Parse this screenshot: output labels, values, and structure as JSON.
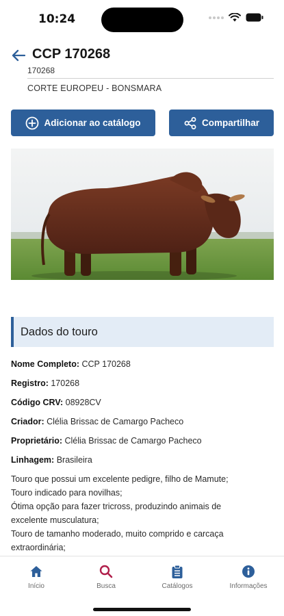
{
  "status": {
    "time": "10:24"
  },
  "header": {
    "title": "CCP 170268",
    "registration": "170268",
    "lineage": "CORTE EUROPEU - BONSMARA"
  },
  "actions": {
    "add_label": "Adicionar ao catálogo",
    "share_label": "Compartilhar"
  },
  "section": {
    "title": "Dados do touro"
  },
  "fields": [
    {
      "label": "Nome Completo:",
      "value": "CCP 170268"
    },
    {
      "label": "Registro:",
      "value": "170268"
    },
    {
      "label": "Código CRV:",
      "value": "08928CV"
    },
    {
      "label": "Criador:",
      "value": "Clélia Brissac de Camargo Pacheco"
    },
    {
      "label": "Proprietário:",
      "value": "Clélia Brissac de Camargo Pacheco"
    },
    {
      "label": "Linhagem:",
      "value": "Brasileira"
    }
  ],
  "description": [
    "Touro que possui um excelente pedigre, filho de Mamute;",
    "Touro indicado para novilhas;",
    "Ótima opção para fazer tricross, produzindo animais de",
    "excelente musculatura;",
    "Touro de tamanho moderado, muito comprido e carcaça",
    "extraordinária;"
  ],
  "tabs": [
    {
      "label": "Início",
      "icon": "home-icon",
      "active": true
    },
    {
      "label": "Busca",
      "icon": "search-icon"
    },
    {
      "label": "Catálogos",
      "icon": "catalog-icon"
    },
    {
      "label": "Informações",
      "icon": "info-icon"
    }
  ],
  "colors": {
    "primary": "#2d5f9a",
    "search_accent": "#b01e4a",
    "section_bg": "#e3ecf6"
  }
}
